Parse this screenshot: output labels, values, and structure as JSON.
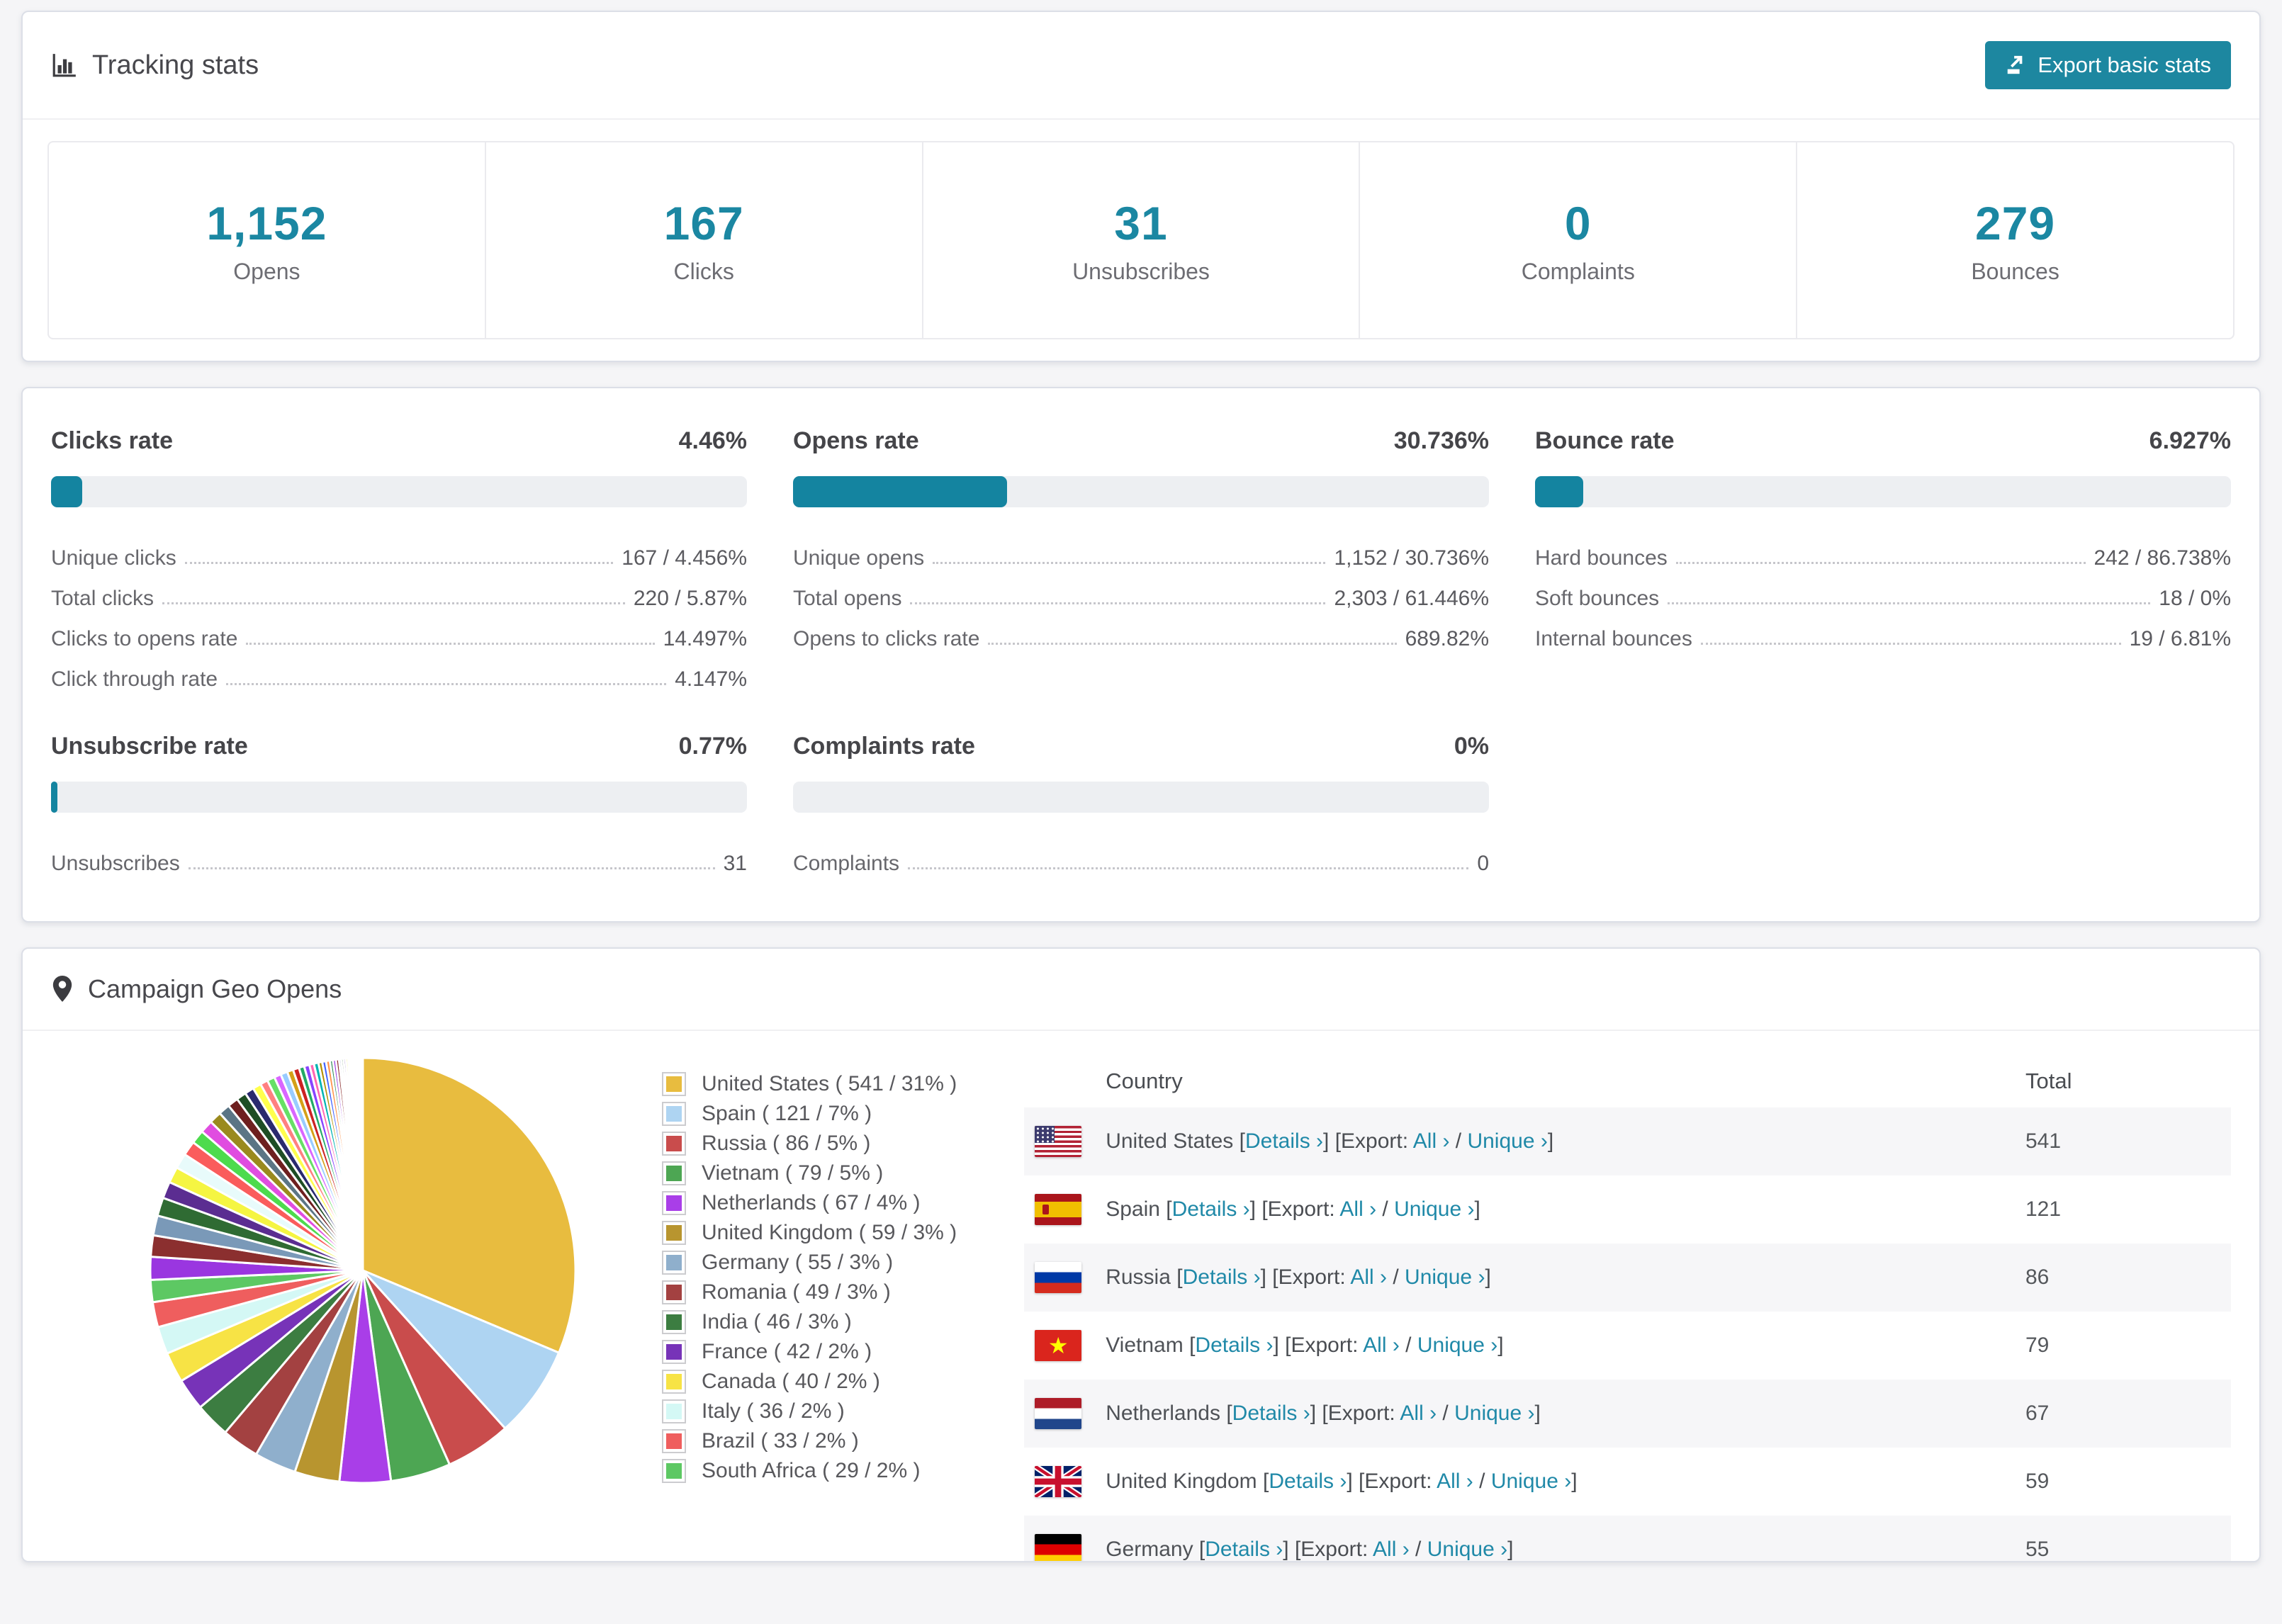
{
  "colors": {
    "accent": "#1d87a0",
    "stat_number": "#1b87a2",
    "link": "#2089a8",
    "bar_track": "#edeff2",
    "bar_fill": "#1484a0",
    "card_bg": "#ffffff",
    "page_bg": "#f5f5f7"
  },
  "tracking": {
    "title": "Tracking stats",
    "export_button": "Export basic stats",
    "stats": [
      {
        "value": "1,152",
        "label": "Opens"
      },
      {
        "value": "167",
        "label": "Clicks"
      },
      {
        "value": "31",
        "label": "Unsubscribes"
      },
      {
        "value": "0",
        "label": "Complaints"
      },
      {
        "value": "279",
        "label": "Bounces"
      }
    ]
  },
  "rates": {
    "clicks": {
      "title": "Clicks rate",
      "value": "4.46%",
      "percent": 4.46,
      "rows": [
        {
          "label": "Unique clicks",
          "value": "167 / 4.456%"
        },
        {
          "label": "Total clicks",
          "value": "220 / 5.87%"
        },
        {
          "label": "Clicks to opens rate",
          "value": "14.497%"
        },
        {
          "label": "Click through rate",
          "value": "4.147%"
        }
      ]
    },
    "opens": {
      "title": "Opens rate",
      "value": "30.736%",
      "percent": 30.736,
      "rows": [
        {
          "label": "Unique opens",
          "value": "1,152 / 30.736%"
        },
        {
          "label": "Total opens",
          "value": "2,303 / 61.446%"
        },
        {
          "label": "Opens to clicks rate",
          "value": "689.82%"
        }
      ]
    },
    "bounce": {
      "title": "Bounce rate",
      "value": "6.927%",
      "percent": 6.927,
      "rows": [
        {
          "label": "Hard bounces",
          "value": "242 / 86.738%"
        },
        {
          "label": "Soft bounces",
          "value": "18 / 0%"
        },
        {
          "label": "Internal bounces",
          "value": "19 / 6.81%"
        }
      ]
    },
    "unsubscribe": {
      "title": "Unsubscribe rate",
      "value": "0.77%",
      "percent": 0.77,
      "rows": [
        {
          "label": "Unsubscribes",
          "value": "31"
        }
      ]
    },
    "complaints": {
      "title": "Complaints rate",
      "value": "0%",
      "percent": 0,
      "rows": [
        {
          "label": "Complaints",
          "value": "0"
        }
      ]
    }
  },
  "geo": {
    "title": "Campaign Geo Opens",
    "table": {
      "headers": [
        "Country",
        "Total"
      ],
      "links": {
        "details": "Details",
        "export_prefix": "[Export:",
        "all": "All",
        "unique": "Unique",
        "chevron": "›",
        "slash": "/"
      },
      "rows": [
        {
          "country": "United States",
          "flag": "us",
          "total": "541"
        },
        {
          "country": "Spain",
          "flag": "es",
          "total": "121"
        },
        {
          "country": "Russia",
          "flag": "ru",
          "total": "86"
        },
        {
          "country": "Vietnam",
          "flag": "vn",
          "total": "79"
        },
        {
          "country": "Netherlands",
          "flag": "nl",
          "total": "67"
        },
        {
          "country": "United Kingdom",
          "flag": "gb",
          "total": "59"
        },
        {
          "country": "Germany",
          "flag": "de",
          "total": "55"
        }
      ]
    }
  },
  "chart_data": {
    "type": "pie",
    "title": "Campaign Geo Opens",
    "legend_position": "right",
    "start_angle_deg": -90,
    "segments": [
      {
        "name": "United States",
        "value": 541,
        "pct": 31,
        "color": "#e8bc3f"
      },
      {
        "name": "Spain",
        "value": 121,
        "pct": 7,
        "color": "#aed4f2"
      },
      {
        "name": "Russia",
        "value": 86,
        "pct": 5,
        "color": "#c94c4c"
      },
      {
        "name": "Vietnam",
        "value": 79,
        "pct": 5,
        "color": "#4da653"
      },
      {
        "name": "Netherlands",
        "value": 67,
        "pct": 4,
        "color": "#a93ee8"
      },
      {
        "name": "United Kingdom",
        "value": 59,
        "pct": 3,
        "color": "#b8952f"
      },
      {
        "name": "Germany",
        "value": 55,
        "pct": 3,
        "color": "#8fafcc"
      },
      {
        "name": "Romania",
        "value": 49,
        "pct": 3,
        "color": "#a34141"
      },
      {
        "name": "India",
        "value": 46,
        "pct": 3,
        "color": "#3c7d41"
      },
      {
        "name": "France",
        "value": 42,
        "pct": 2,
        "color": "#7733b8"
      },
      {
        "name": "Canada",
        "value": 40,
        "pct": 2,
        "color": "#f7e345"
      },
      {
        "name": "Italy",
        "value": 36,
        "pct": 2,
        "color": "#d4f8f5"
      },
      {
        "name": "Brazil",
        "value": 33,
        "pct": 2,
        "color": "#ef5e5e"
      },
      {
        "name": "South Africa",
        "value": 29,
        "pct": 2,
        "color": "#5dc863"
      }
    ],
    "other_segments": [
      30,
      28,
      26,
      24,
      22,
      21,
      20,
      19,
      18,
      17,
      16,
      15,
      14,
      13,
      12,
      11,
      10,
      10,
      9,
      9,
      8,
      8,
      7,
      7,
      6,
      6,
      5,
      5,
      5,
      4,
      4,
      4,
      3,
      3,
      3,
      3,
      2,
      2,
      2,
      2,
      2,
      1,
      1,
      1,
      1,
      1,
      1,
      1,
      1,
      1
    ],
    "other_colors": [
      "#9a36e0",
      "#8b2f2f",
      "#7a99b8",
      "#2f6b33",
      "#5b2d91",
      "#f5f542",
      "#e8fbfb",
      "#fa5c5c",
      "#4ddb4d",
      "#e04de0",
      "#9a8a1e",
      "#5b7585",
      "#6e1f1f",
      "#1e4d24",
      "#2a2a6e",
      "#ffff4d",
      "#ff8080",
      "#66e066",
      "#d966ff",
      "#99ccff",
      "#d4a017",
      "#cc2222",
      "#22aa66",
      "#8844ff",
      "#ff66b2",
      "#00b3b3",
      "#b38f00",
      "#4466ff",
      "#ff944d",
      "#2e8b57"
    ]
  }
}
